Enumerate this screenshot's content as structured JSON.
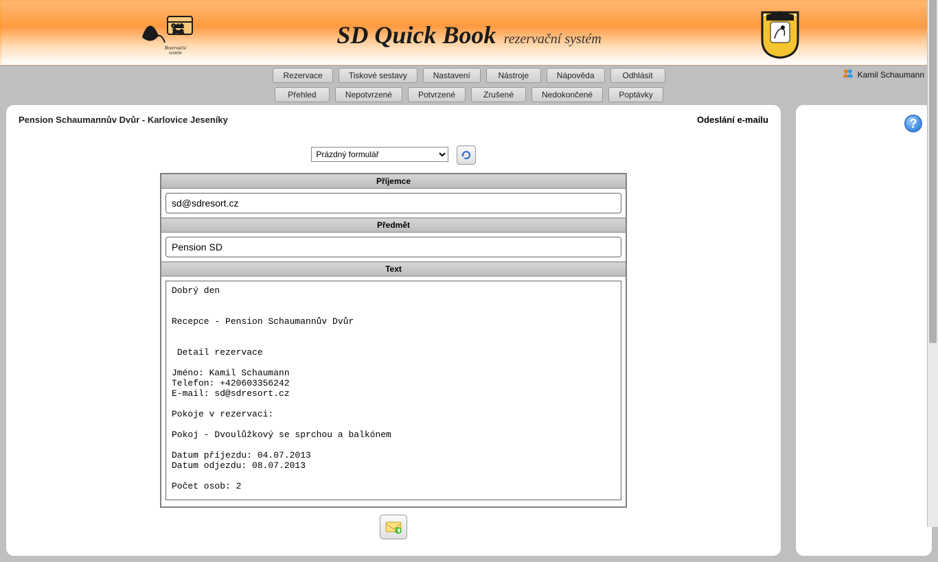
{
  "header": {
    "title_big": "SD Quick Book",
    "title_sub": "rezervační systém"
  },
  "user": {
    "name": "Kamil Schaumann"
  },
  "main_nav": [
    "Rezervace",
    "Tiskové sestavy",
    "Nastavení",
    "Nástroje",
    "Nápověda",
    "Odhlásit"
  ],
  "sub_nav": [
    "Přehled",
    "Nepotvrzené",
    "Potvrzené",
    "Zrušené",
    "Nedokončené",
    "Poptávky"
  ],
  "page": {
    "title": "Pension Schaumannův Dvůr - Karlovice Jeseníky",
    "section": "Odeslání e-mailu",
    "template_select": "Prázdný formulář"
  },
  "form": {
    "labels": {
      "recipient": "Příjemce",
      "subject": "Předmět",
      "body": "Text"
    },
    "recipient": "sd@sdresort.cz",
    "subject": "Pension SD",
    "body": "Dobrý den\n\n\nRecepce - Pension Schaumannův Dvůr\n\n\n Detail rezervace\n\nJméno: Kamil Schaumann\nTelefon: +420603356242\nE-mail: sd@sdresort.cz\n\nPokoje v rezervaci:\n\nPokoj - Dvoulůžkový se sprchou a balkónem\n\nDatum příjezdu: 04.07.2013\nDatum odjezdu: 08.07.2013\n\nPočet osob: 2"
  },
  "help": "?"
}
